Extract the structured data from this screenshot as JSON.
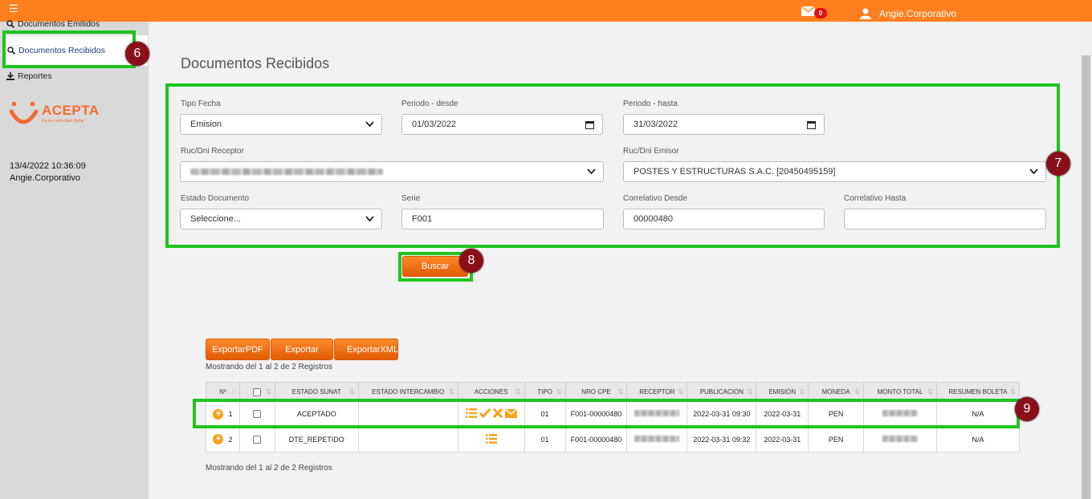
{
  "topbar": {
    "menu_icon": "hamburger-icon",
    "mail_icon": "envelope-icon",
    "mail_count": "0",
    "user_icon": "user-icon",
    "user_name": "Angie.Corporativo",
    "color": "#ff7f1f"
  },
  "sidebar": {
    "items": [
      {
        "label": "Documentos Emitidos",
        "icon": "search-icon"
      },
      {
        "label": "Documentos Recibidos",
        "icon": "search-icon"
      },
      {
        "label": "Reportes",
        "icon": "download-icon"
      }
    ],
    "logo": {
      "name": "ACEPTA",
      "tagline": "Pa la e velocidad digital"
    },
    "datetime": "13/4/2022 10:36:09",
    "user": "Angie.Corporativo"
  },
  "main": {
    "title": "Documentos Recibidos",
    "filters": {
      "tipo_fecha": {
        "label": "Tipo Fecha",
        "value": "Emision"
      },
      "periodo_desde": {
        "label": "Periodo - desde",
        "value": "01/03/2022"
      },
      "periodo_hasta": {
        "label": "Periodo - hasta",
        "value": "31/03/2022"
      },
      "ruc_receptor": {
        "label": "Ruc/Dni Receptor",
        "value": ""
      },
      "ruc_emisor": {
        "label": "Ruc/Dni Emisor",
        "value": "POSTES Y ESTRUCTURAS S.A.C. [20450495159]"
      },
      "estado_documento": {
        "label": "Estado Documento",
        "value": "Seleccione..."
      },
      "serie": {
        "label": "Serie",
        "value": "F001"
      },
      "correlativo_desde": {
        "label": "Correlativo Desde",
        "value": "00000480"
      },
      "correlativo_hasta": {
        "label": "Correlativo Hasta",
        "value": ""
      }
    },
    "search_button": "Buscar",
    "export_buttons": [
      "ExportarPDF",
      "Exportar",
      "ExportarXML"
    ],
    "records_info": "Mostrando del 1 al 2 de 2 Registros",
    "table": {
      "headers": [
        "Nº",
        "",
        "ESTADO SUNAT",
        "ESTADO INTERCAMBIO",
        "ACCIONES",
        "TIPO",
        "NRO CPE",
        "RECEPTOR",
        "PUBLICACION",
        "EMISION",
        "MONEDA",
        "MONTO TOTAL",
        "RESUMEN BOLETA"
      ],
      "rows": [
        {
          "n": "1",
          "estado_sunat": "ACEPTADO",
          "estado_intercambio": "",
          "tipo": "01",
          "nro_cpe": "F001-00000480",
          "receptor": "",
          "publicacion": "2022-03-31 09:30",
          "emision": "2022-03-31",
          "moneda": "PEN",
          "monto": "",
          "resumen": "N/A",
          "acciones": [
            "list-icon",
            "check-icon",
            "x-icon",
            "envelope-icon"
          ]
        },
        {
          "n": "2",
          "estado_sunat": "DTE_REPETIDO",
          "estado_intercambio": "",
          "tipo": "01",
          "nro_cpe": "F001-00000480",
          "receptor": "",
          "publicacion": "2022-03-31 09:32",
          "emision": "2022-03-31",
          "moneda": "PEN",
          "monto": "",
          "resumen": "N/A",
          "acciones": [
            "list-icon"
          ]
        }
      ]
    }
  },
  "annotations": {
    "steps": [
      "6",
      "7",
      "8",
      "9"
    ],
    "highlight_color": "#1ec41e",
    "marker_color": "#8b0f1a"
  }
}
